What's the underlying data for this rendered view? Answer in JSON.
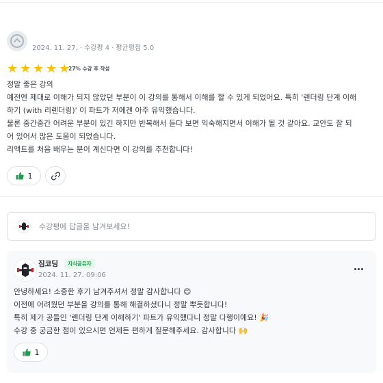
{
  "review": {
    "date": "2024. 11. 27.",
    "course_count": "수강평 4",
    "average": "평균평점 5.0",
    "rating": 5,
    "rating_max": 5,
    "progress_note": "27% 수강 후 작성",
    "lines": [
      "정말 좋은 강의",
      "예전엔 제대로 이해가 되지 않았던 부분이 이 강의를 통해서 이해를 할 수 있게 되었어요. 특히 '렌더링 단계 이해",
      "하기 (with 리렌더링)' 이 파트가 저에겐 아주 유익했습니다.",
      "물론 중간중간 어려운 부분이 있긴 하지만 반복해서 듣다 보면 익숙해지면서 이해가 될 것 같아요. 교안도 잘 되",
      "어 있어서 많은 도움이 되었습니다.",
      "리액트를 처음 배우는 분이 계신다면 이 강의를 추천합니다!"
    ],
    "like_count": "1"
  },
  "reply_input": {
    "placeholder": "수강평에 답글을 남겨보세요!"
  },
  "answer": {
    "name": "짐코딩",
    "badge": "지식공유자",
    "date": "2024. 11. 27. 09:06",
    "lines": [
      "안녕하세요! 소중한 후기 남겨주셔서 정말 감사합니다 😊",
      "이전에 어려웠던 부분을 강의를 통해 해결하셨다니 정말 뿌듯합니다!",
      "특히 제가 공들인 '렌더링 단계 이해하기' 파트가 유익했다니 정말 다행이에요! 🎉",
      "수강 중 궁금한 점이 있으시면 언제든 편하게 질문해주세요. 감사합니다 🙌"
    ],
    "like_count": "1"
  },
  "colors": {
    "star": "#fdc000",
    "badge_text": "#1a9e4b",
    "badge_bg": "#e6f7ec",
    "card_bg": "#f8f9fa"
  },
  "icons": [
    "user-avatar-icon",
    "star-icon",
    "thumbs-up-icon",
    "link-icon",
    "gym-coding-logo-icon",
    "more-horizontal-icon"
  ]
}
